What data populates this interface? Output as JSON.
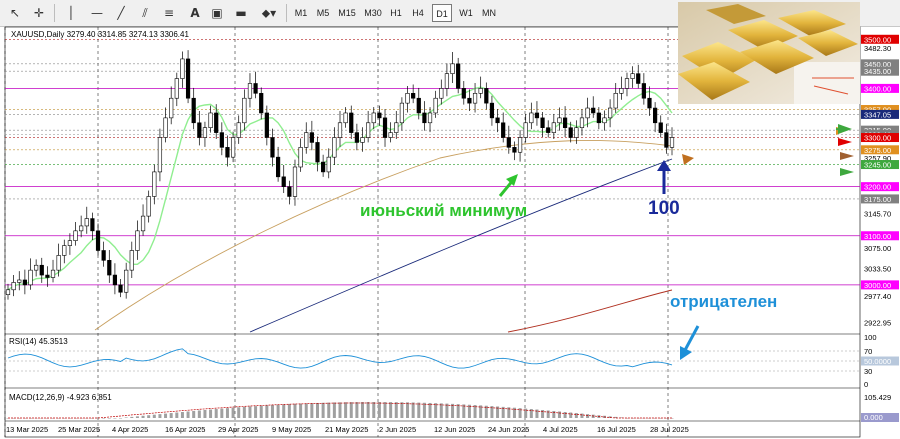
{
  "toolbar": {
    "timeframes": [
      "M1",
      "M5",
      "M15",
      "M30",
      "H1",
      "H4",
      "D1",
      "W1",
      "MN"
    ],
    "active_timeframe": "D1",
    "icons": [
      "cursor-icon",
      "crosshair-icon",
      "horizontal-line-icon",
      "trendline-icon",
      "channel-icon",
      "fibonacci-icon",
      "text-icon",
      "label-icon",
      "shapes-icon",
      "arrow-tools-icon"
    ]
  },
  "chart": {
    "symbol_header": "XAUUSD,Daily  3279.40 3314.85 3274.13 3306.41",
    "rsi_label": "RSI(14) 45.3513",
    "macd_label": "MACD(12,26,9) -4.923 6.851",
    "annotations": {
      "june_low": "июньский минимум",
      "ma_label": "100",
      "rsi_note": "отрицателен"
    },
    "colors": {
      "ma_fast": "#90ee90",
      "ma_mid": "#c8a060",
      "ma_100": "#1a2a7a",
      "ma_slow": "#b03020",
      "level_line": "#c000c0",
      "tag_magenta": "#ff00ff",
      "tag_red": "#e00000",
      "tag_green": "#3ea83e",
      "tag_gray": "#808080",
      "tag_orange": "#e09020",
      "tag_navy": "#1a2a7a",
      "annotation_green": "#2ec42e",
      "annotation_blue": "#1a2a9a",
      "annotation_cyan": "#1e90d8"
    }
  },
  "chart_data": {
    "type": "candlestick",
    "price_ylim": [
      2900,
      3525
    ],
    "price_ticks": [
      {
        "v": 3500,
        "label": "3500.00",
        "tag": "tag_red"
      },
      {
        "v": 3482.3,
        "label": "3482.30",
        "tag": null
      },
      {
        "v": 3450,
        "label": "3450.00",
        "tag": "tag_gray"
      },
      {
        "v": 3435,
        "label": "3435.00",
        "tag": "tag_gray"
      },
      {
        "v": 3400,
        "label": "3400.00",
        "tag": "tag_magenta"
      },
      {
        "v": 3357,
        "label": "3357.00",
        "tag": "tag_orange"
      },
      {
        "v": 3347.05,
        "label": "3347.05",
        "tag": "tag_navy"
      },
      {
        "v": 3315,
        "label": "3315.00",
        "tag": "tag_gray"
      },
      {
        "v": 3306.41,
        "label": "3306.41",
        "tag": "tag_gray"
      },
      {
        "v": 3300,
        "label": "3300.00",
        "tag": "tag_red"
      },
      {
        "v": 3275,
        "label": "3275.00",
        "tag": "tag_orange"
      },
      {
        "v": 3257.9,
        "label": "3257.90",
        "tag": null
      },
      {
        "v": 3245,
        "label": "3245.00",
        "tag": "tag_green"
      },
      {
        "v": 3200,
        "label": "3200.00",
        "tag": "tag_magenta"
      },
      {
        "v": 3175,
        "label": "3175.00",
        "tag": "tag_gray"
      },
      {
        "v": 3145.7,
        "label": "3145.70",
        "tag": null
      },
      {
        "v": 3100,
        "label": "3100.00",
        "tag": "tag_magenta"
      },
      {
        "v": 3075,
        "label": "3075.00",
        "tag": null
      },
      {
        "v": 3033.5,
        "label": "3033.50",
        "tag": null
      },
      {
        "v": 3000,
        "label": "3000.00",
        "tag": "tag_magenta"
      },
      {
        "v": 2977.4,
        "label": "2977.40",
        "tag": null
      },
      {
        "v": 2922.95,
        "label": "2922.95",
        "tag": null
      }
    ],
    "dates": [
      "13 Mar 2025",
      "25 Mar 2025",
      "4 Apr 2025",
      "16 Apr 2025",
      "29 Apr 2025",
      "9 May 2025",
      "21 May 2025",
      "2 Jun 2025",
      "12 Jun 2025",
      "24 Jun 2025",
      "4 Jul 2025",
      "16 Jul 2025",
      "28 Jul 2025"
    ],
    "rsi": {
      "ylim": [
        0,
        100
      ],
      "ticks": [
        {
          "v": 70,
          "label": "70"
        },
        {
          "v": 50,
          "label": "50.0000"
        },
        {
          "v": 30,
          "label": "30"
        }
      ]
    },
    "macd": {
      "ticks": [
        {
          "label": "105.429"
        },
        {
          "label": "0.000"
        }
      ]
    }
  }
}
